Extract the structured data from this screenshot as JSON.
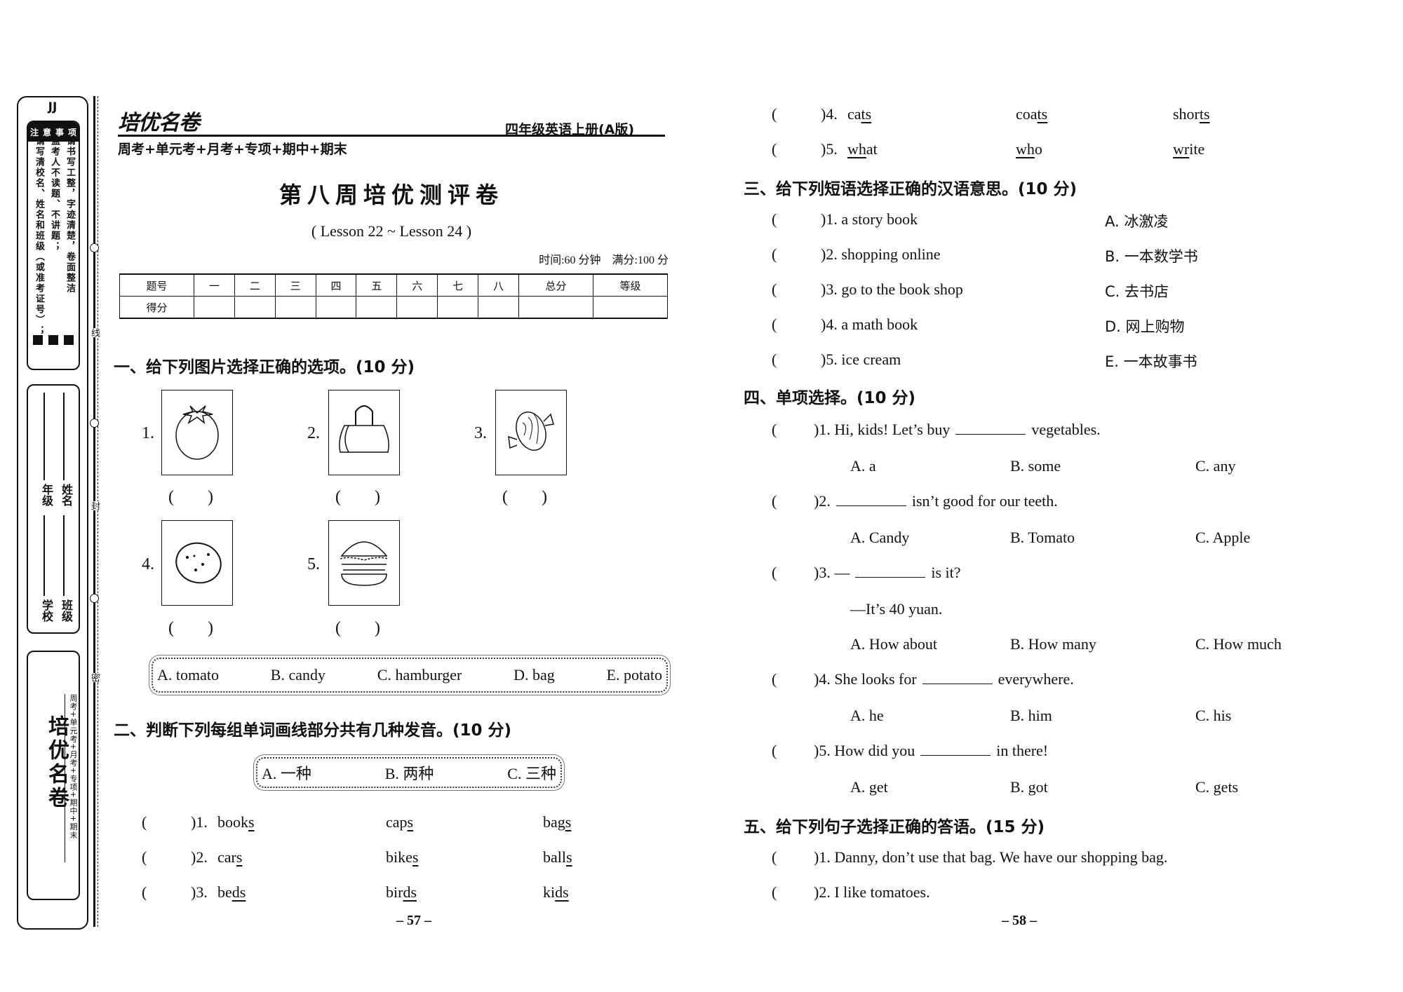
{
  "binding_strip": {
    "edition_tag": "JJ",
    "notice_label": [
      "注",
      "意",
      "事",
      "项"
    ],
    "notice_items": [
      "请写清校名、姓名和班级（或准考证号）；",
      "监考人不读题、不讲题；",
      "请书写工整，字迹清楚，卷面整洁"
    ],
    "fields": [
      "学校",
      "年级",
      "班级",
      "姓名"
    ],
    "brand_name": "培优名卷",
    "brand_subtitle": "周考+单元考+月考+专项+期中+期末",
    "binding_marks": [
      "线",
      "封",
      "密"
    ]
  },
  "header": {
    "logo": "培优名卷",
    "book": "四年级英语上册(A版)",
    "series": "周考+单元考+月考+专项+期中+期末"
  },
  "title": "第八周培优测评卷",
  "lesson_range": "( Lesson 22 ~ Lesson 24 )",
  "time_info": "时间:60 分钟　满分:100 分",
  "score_table": {
    "header": [
      "题号",
      "一",
      "二",
      "三",
      "四",
      "五",
      "六",
      "七",
      "八",
      "总分",
      "等级"
    ],
    "row_label": "得分",
    "scores": [
      "",
      "",
      "",
      "",
      "",
      "",
      "",
      "",
      "",
      ""
    ]
  },
  "section1": {
    "heading": "一、给下列图片选择正确的选项。(10 分)",
    "pictures": [
      {
        "num": "1.",
        "icon": "tomato-icon",
        "answer": "(　　)"
      },
      {
        "num": "2.",
        "icon": "bag-icon",
        "answer": "(　　)"
      },
      {
        "num": "3.",
        "icon": "candy-icon",
        "answer": "(　　)"
      },
      {
        "num": "4.",
        "icon": "potato-icon",
        "answer": "(　　)"
      },
      {
        "num": "5.",
        "icon": "hamburger-icon",
        "answer": "(　　)"
      }
    ],
    "options": [
      "A. tomato",
      "B. candy",
      "C. hamburger",
      "D. bag",
      "E. potato"
    ]
  },
  "section2": {
    "heading": "二、判断下列每组单词画线部分共有几种发音。(10 分)",
    "options": [
      "A. 一种",
      "B. 两种",
      "C. 三种"
    ],
    "items": [
      {
        "num": ")1.",
        "words": [
          [
            "book",
            "s"
          ],
          [
            "cap",
            "s"
          ],
          [
            "bag",
            "s"
          ]
        ]
      },
      {
        "num": ")2.",
        "words": [
          [
            "car",
            "s"
          ],
          [
            "bike",
            "s"
          ],
          [
            "ball",
            "s"
          ]
        ]
      },
      {
        "num": ")3.",
        "words": [
          [
            "be",
            "ds"
          ],
          [
            "bir",
            "ds"
          ],
          [
            "ki",
            "ds"
          ]
        ]
      },
      {
        "num": ")4.",
        "words": [
          [
            "ca",
            "ts"
          ],
          [
            "coa",
            "ts"
          ],
          [
            "shor",
            "ts"
          ]
        ]
      },
      {
        "num": ")5.",
        "words": [
          [
            "",
            "wh",
            "at"
          ],
          [
            "",
            "wh",
            "o"
          ],
          [
            "",
            "wr",
            "ite"
          ]
        ]
      }
    ]
  },
  "section3": {
    "heading": "三、给下列短语选择正确的汉语意思。(10 分)",
    "items": [
      {
        "phrase": ")1. a story book",
        "option": "A. 冰激凌"
      },
      {
        "phrase": ")2. shopping online",
        "option": "B. 一本数学书"
      },
      {
        "phrase": ")3. go to the book shop",
        "option": "C. 去书店"
      },
      {
        "phrase": ")4. a math book",
        "option": "D. 网上购物"
      },
      {
        "phrase": ")5. ice cream",
        "option": "E. 一本故事书"
      }
    ]
  },
  "section4": {
    "heading": "四、单项选择。(10 分)",
    "items": [
      {
        "pre": ")1. Hi, kids! Let’s buy",
        "post": "vegetables.",
        "extra": "",
        "options": [
          "A. a",
          "B. some",
          "C. any"
        ]
      },
      {
        "pre": ")2.",
        "post": "isn’t good for our teeth.",
        "extra": "",
        "options": [
          "A. Candy",
          "B. Tomato",
          "C. Apple"
        ]
      },
      {
        "pre": ")3. —",
        "post": "is it?",
        "extra": "—It’s 40 yuan.",
        "options": [
          "A. How about",
          "B. How many",
          "C. How much"
        ]
      },
      {
        "pre": ")4. She looks for",
        "post": "everywhere.",
        "extra": "",
        "options": [
          "A. he",
          "B. him",
          "C. his"
        ]
      },
      {
        "pre": ")5. How did you",
        "post": "in there!",
        "extra": "",
        "options": [
          "A. get",
          "B. got",
          "C. gets"
        ]
      }
    ]
  },
  "section5": {
    "heading": "五、给下列句子选择正确的答语。(15 分)",
    "items": [
      ")1. Danny, don’t use that bag. We have our shopping bag.",
      ")2. I like tomatoes."
    ]
  },
  "page_numbers": {
    "left": "– 57 –",
    "right": "– 58 –"
  }
}
